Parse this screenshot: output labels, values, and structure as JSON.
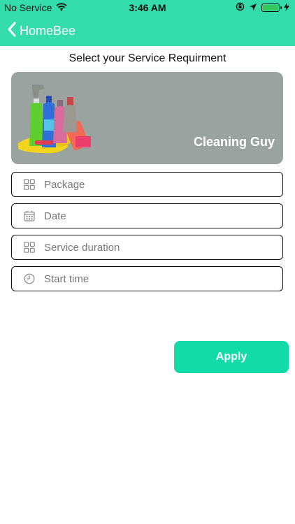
{
  "status_bar": {
    "carrier": "No Service",
    "time": "3:46 AM",
    "icons": [
      "wifi-icon",
      "orientation-lock-icon",
      "location-icon",
      "battery-icon",
      "charging-icon"
    ]
  },
  "nav": {
    "back_label": "HomeBee",
    "back_icon": "chevron-left-icon"
  },
  "heading": "Select your Service Requirment",
  "banner": {
    "title": "Cleaning Guy",
    "image": "cleaning-supplies-image"
  },
  "fields": [
    {
      "icon": "grid-icon",
      "placeholder": "Package"
    },
    {
      "icon": "calendar-icon",
      "placeholder": "Date"
    },
    {
      "icon": "grid-icon",
      "placeholder": "Service duration"
    },
    {
      "icon": "clock-icon",
      "placeholder": "Start time"
    }
  ],
  "apply_label": "Apply",
  "colors": {
    "header": "#33dcaa",
    "button": "#12dba8",
    "banner_bg": "#9aa3a0",
    "field_border": "#111111",
    "placeholder": "#777777"
  }
}
